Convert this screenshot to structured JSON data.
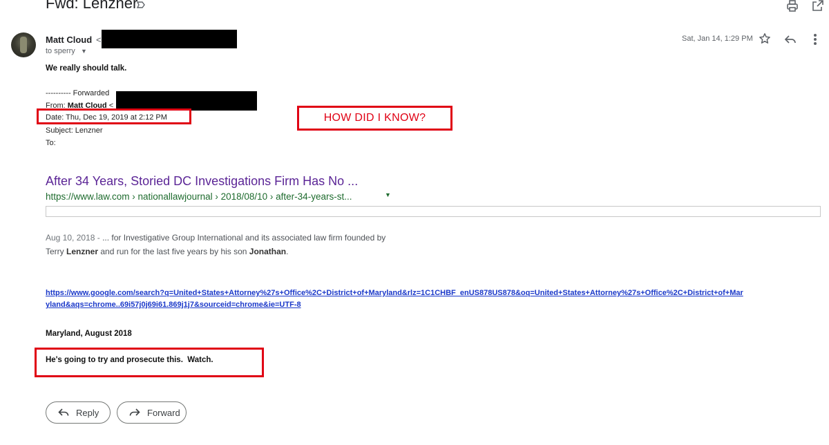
{
  "email": {
    "subject": "Fwd: Lenzner",
    "sender_name": "Matt Cloud",
    "sender_lt": "<",
    "to_line": "to sperry",
    "date": "Sat, Jan 14, 1:29 PM"
  },
  "body": {
    "first_line": "We really should talk.",
    "forwarded_line": "---------- Forwarded",
    "from_label": "From:",
    "from_name": "Matt Cloud",
    "from_lt": "<",
    "date_line": "Date: Thu, Dec 19, 2019 at 2:12 PM",
    "subject_line": "Subject: Lenzner",
    "to_line": "To:",
    "annotation": "HOW DID I KNOW?",
    "result": {
      "title": "After 34 Years, Storied DC Investigations Firm Has No ...",
      "url": "https://www.law.com › nationallawjournal › 2018/08/10 › after-34-years-st...",
      "snippet_date": "Aug 10, 2018 - ",
      "snippet_line1": "... for Investigative Group International and its associated law firm founded by",
      "snippet_terry": "Terry ",
      "snippet_lenzner": "Lenzner",
      "snippet_mid": " and run for the last five years by his son ",
      "snippet_jonathan": "Jonathan",
      "snippet_end": "."
    },
    "link": "https://www.google.com/search?q=United+States+Attorney%27s+Office%2C+District+of+Maryland&rlz=1C1CHBF_enUS878US878&oq=United+States+Attorney%27s+Office%2C+District+of+Maryland&aqs=chrome..69i57j0j69i61.869j1j7&sourceid=chrome&ie=UTF-8",
    "maryland_line": "Maryland, August 2018",
    "watch_line": "He's going to try and prosecute this.  Watch."
  },
  "actions": {
    "reply_label": "Reply",
    "forward_label": "Forward"
  },
  "colors": {
    "annotation_red": "#e00014",
    "link_blue": "#1a38c9",
    "visited_purple": "#5b2596",
    "url_green": "#1e6b2e"
  },
  "icons": [
    "label-icon",
    "print-icon",
    "open-in-new-window-icon",
    "star-icon",
    "reply-icon",
    "more-vert-icon",
    "dropdown-caret-icon",
    "forward-icon"
  ]
}
